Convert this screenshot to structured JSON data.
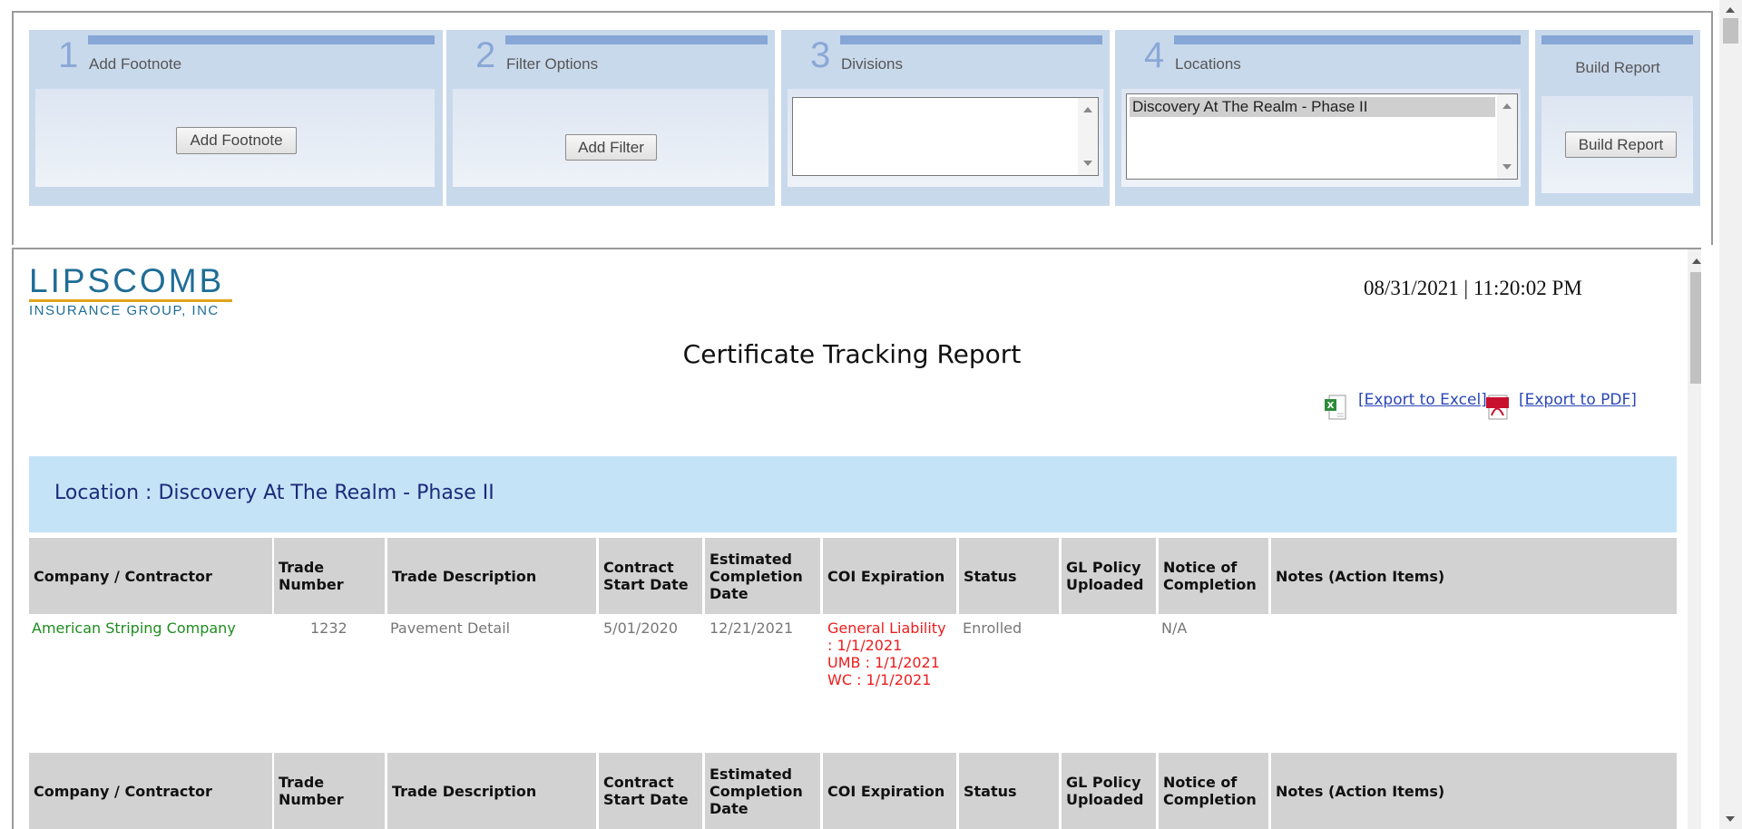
{
  "wizard": {
    "steps": [
      {
        "number": "1",
        "title": "Add Footnote",
        "button": "Add Footnote"
      },
      {
        "number": "2",
        "title": "Filter Options",
        "button": "Add Filter"
      },
      {
        "number": "3",
        "title": "Divisions"
      },
      {
        "number": "4",
        "title": "Locations",
        "selected_option": "Discovery At The Realm - Phase II"
      }
    ],
    "build": {
      "title": "Build Report",
      "button": "Build Report"
    }
  },
  "report": {
    "logo": {
      "name": "LIPSCOMB",
      "sub": "INSURANCE GROUP, INC"
    },
    "datetime": "08/31/2021 | 11:20:02 PM",
    "title": "Certificate Tracking Report",
    "export_excel": "[Export to Excel]",
    "export_pdf": "[Export to PDF]",
    "location": "Location : Discovery At The Realm - Phase II",
    "columns": [
      "Company / Contractor",
      "Trade Number",
      "Trade Description",
      "Contract Start Date",
      "Estimated Completion Date",
      "COI Expiration",
      "Status",
      "GL Policy Uploaded",
      "Notice of Completion",
      "Notes (Action Items)"
    ],
    "rows": [
      {
        "company": "American Striping Company",
        "trade_number": "1232",
        "trade_description": "Pavement Detail",
        "contract_start": "5/01/2020",
        "estimated_completion": "12/21/2021",
        "coi": [
          "General Liability",
          ": 1/1/2021",
          "UMB : 1/1/2021",
          "WC : 1/1/2021"
        ],
        "status": "Enrolled",
        "gl_policy": "",
        "notice_of_completion": "N/A",
        "notes": ""
      }
    ]
  },
  "colors": {
    "panel": "#c9d9ec",
    "panel_bar": "#86a6d6",
    "location_bar": "#c5e3f6",
    "header": "#d2d2d2",
    "coi": "#ee1c1c",
    "company": "#1f8c1f",
    "link": "#2a47b8"
  }
}
